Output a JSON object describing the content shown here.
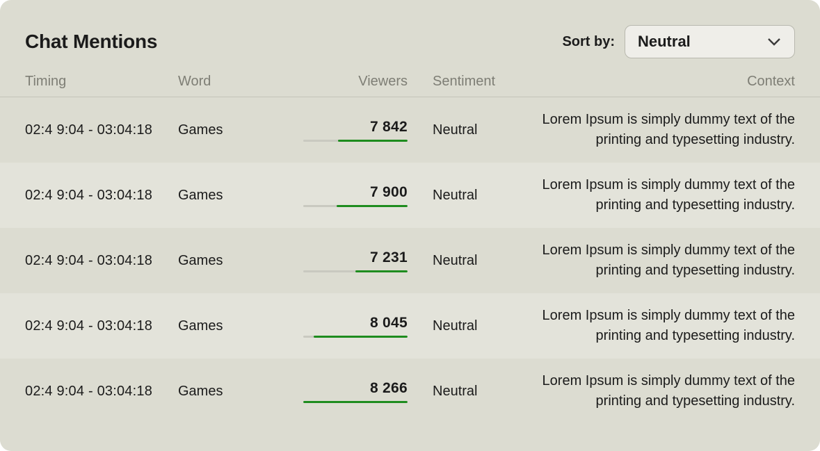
{
  "title": "Chat Mentions",
  "sort": {
    "label": "Sort by:",
    "value": "Neutral"
  },
  "columns": {
    "timing": "Timing",
    "word": "Word",
    "viewers": "Viewers",
    "sentiment": "Sentiment",
    "context": "Context"
  },
  "rows": [
    {
      "timing": "02:4 9:04 - 03:04:18",
      "word": "Games",
      "viewers": "7 842",
      "viewers_pct": 67,
      "sentiment": "Neutral",
      "context": "Lorem Ipsum is simply dummy text of the printing and typesetting industry."
    },
    {
      "timing": "02:4 9:04 - 03:04:18",
      "word": "Games",
      "viewers": "7 900",
      "viewers_pct": 68,
      "sentiment": "Neutral",
      "context": "Lorem Ipsum is simply dummy text of the printing and typesetting industry."
    },
    {
      "timing": "02:4 9:04 - 03:04:18",
      "word": "Games",
      "viewers": "7 231",
      "viewers_pct": 50,
      "sentiment": "Neutral",
      "context": "Lorem Ipsum is simply dummy text of the printing and typesetting industry."
    },
    {
      "timing": "02:4 9:04 - 03:04:18",
      "word": "Games",
      "viewers": "8 045",
      "viewers_pct": 90,
      "sentiment": "Neutral",
      "context": "Lorem Ipsum is simply dummy text of the printing and typesetting industry."
    },
    {
      "timing": "02:4 9:04 - 03:04:18",
      "word": "Games",
      "viewers": "8 266",
      "viewers_pct": 100,
      "sentiment": "Neutral",
      "context": "Lorem Ipsum is simply dummy text of the printing and typesetting industry."
    }
  ],
  "colors": {
    "accent_green": "#1e8c1e",
    "bg": "#dcdcd1",
    "bg_alt": "#e3e3da",
    "select_bg": "#efeee9"
  }
}
